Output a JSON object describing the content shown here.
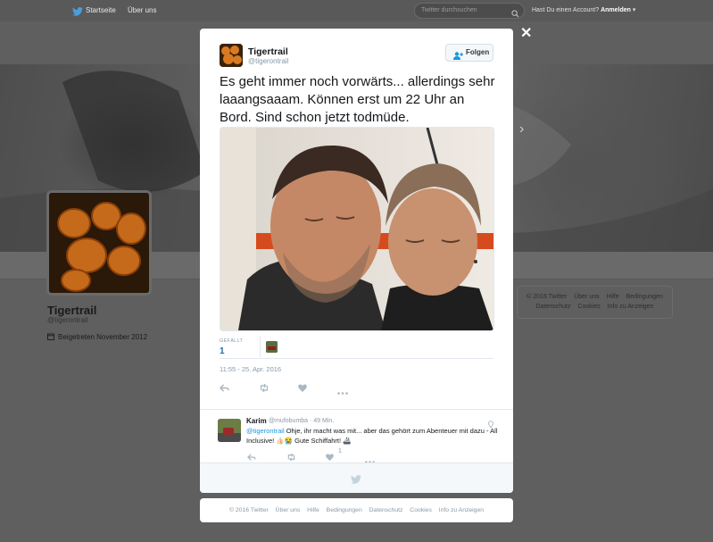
{
  "nav": {
    "home_label": "Startseite",
    "about_label": "Über uns",
    "search_placeholder": "Twitter durchsuchen",
    "have_account": "Hast Du einen Account?",
    "login_label": "Anmelden"
  },
  "profile": {
    "name": "Tigertrail",
    "handle": "@tigerontrail",
    "joined": "Beigetreten November 2012"
  },
  "side_footer": {
    "line1": [
      "© 2016 Twitter",
      "Über uns",
      "Hilfe",
      "Bedingungen"
    ],
    "line2": [
      "Datenschutz",
      "Cookies",
      "Info zu Anzeigen"
    ]
  },
  "tweet": {
    "author_name": "Tigertrail",
    "author_handle": "@tigerontrail",
    "follow_label": "Folgen",
    "text": "Es geht immer noch vorwärts... allerdings sehr laaangsaaam. Können erst um 22 Uhr an Bord. Sind schon jetzt todmüde.",
    "likes_label": "GEFÄLLT",
    "likes_count": "1",
    "timestamp": "11:55 - 25. Apr. 2016"
  },
  "reply": {
    "name": "Karim",
    "meta": "@mufobumba · 49 Min.",
    "mention": "@tigerontrail",
    "text": " Ohje, ihr macht was mit... aber das gehört zum Abenteuer mit dazu - All Inclusive! 👍🏻😭 Gute Schiffahrt! 🚢",
    "like_count": "1"
  },
  "footer": {
    "items": [
      "© 2016 Twitter",
      "Über uns",
      "Hilfe",
      "Bedingungen",
      "Datenschutz",
      "Cookies",
      "Info zu Anzeigen"
    ]
  },
  "icons": {
    "twitter_blue": "#1da1f2",
    "link_blue": "#1b95e0",
    "action_gray": "#aab8c2"
  },
  "close_symbol": "✕",
  "banner_next_symbol": "›"
}
